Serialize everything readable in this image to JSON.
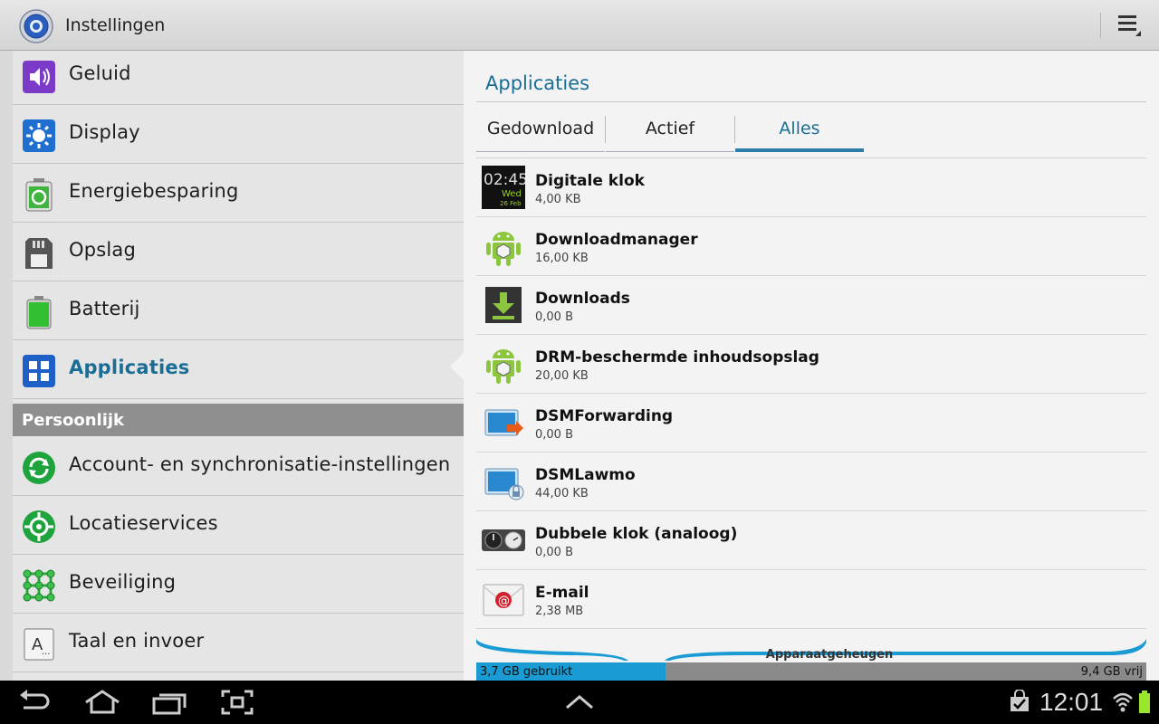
{
  "actionbar": {
    "title": "Instellingen",
    "app_icon": "settings-gear-icon",
    "menu_icon": "overflow-menu-icon"
  },
  "sidebar": {
    "items": [
      {
        "label": "Geluid",
        "icon": "sound-icon"
      },
      {
        "label": "Display",
        "icon": "display-brightness-icon"
      },
      {
        "label": "Energiebesparing",
        "icon": "power-saving-icon"
      },
      {
        "label": "Opslag",
        "icon": "sd-card-icon"
      },
      {
        "label": "Batterij",
        "icon": "battery-icon"
      },
      {
        "label": "Applicaties",
        "icon": "applications-grid-icon",
        "active": true
      }
    ],
    "section_header": "Persoonlijk",
    "personal_items": [
      {
        "label": "Account- en synchronisatie-instellingen",
        "icon": "sync-icon"
      },
      {
        "label": "Locatieservices",
        "icon": "location-icon"
      },
      {
        "label": "Beveiliging",
        "icon": "security-pattern-icon"
      },
      {
        "label": "Taal en invoer",
        "icon": "language-input-icon"
      }
    ]
  },
  "main": {
    "title": "Applicaties",
    "tabs": [
      {
        "label": "Gedownload"
      },
      {
        "label": "Actief"
      },
      {
        "label": "Alles",
        "selected": true
      }
    ],
    "apps": [
      {
        "name": "Digitale klok",
        "size": "4,00 KB",
        "icon": "digital-clock-icon",
        "clock_time": "02:45",
        "clock_day": "Wed",
        "clock_date": "26 Feb"
      },
      {
        "name": "Downloadmanager",
        "size": "16,00 KB",
        "icon": "android-icon"
      },
      {
        "name": "Downloads",
        "size": "0,00 B",
        "icon": "download-arrow-icon"
      },
      {
        "name": "DRM-beschermde inhoudsopslag",
        "size": "20,00 KB",
        "icon": "android-icon"
      },
      {
        "name": "DSMForwarding",
        "size": "0,00 B",
        "icon": "dsm-forwarding-icon"
      },
      {
        "name": "DSMLawmo",
        "size": "44,00 KB",
        "icon": "dsm-lawmo-icon"
      },
      {
        "name": "Dubbele klok (analoog)",
        "size": "0,00 B",
        "icon": "dual-analog-clock-icon"
      },
      {
        "name": "E-mail",
        "size": "2,38 MB",
        "icon": "email-icon"
      }
    ],
    "storage": {
      "label": "Apparaatgeheugen",
      "used_label": "3,7 GB gebruikt",
      "free_label": "9,4 GB vrij",
      "used_fraction": 0.282
    }
  },
  "sysbar": {
    "time": "12:01",
    "icons": [
      "back-icon",
      "home-icon",
      "recent-apps-icon",
      "screenshot-icon",
      "up-arrow-icon",
      "notification-bag-icon",
      "wifi-icon",
      "battery-icon"
    ]
  },
  "colors": {
    "accent": "#1a6e96",
    "storage_used": "#1a9bd4",
    "section_bg": "#8f8f8f"
  }
}
